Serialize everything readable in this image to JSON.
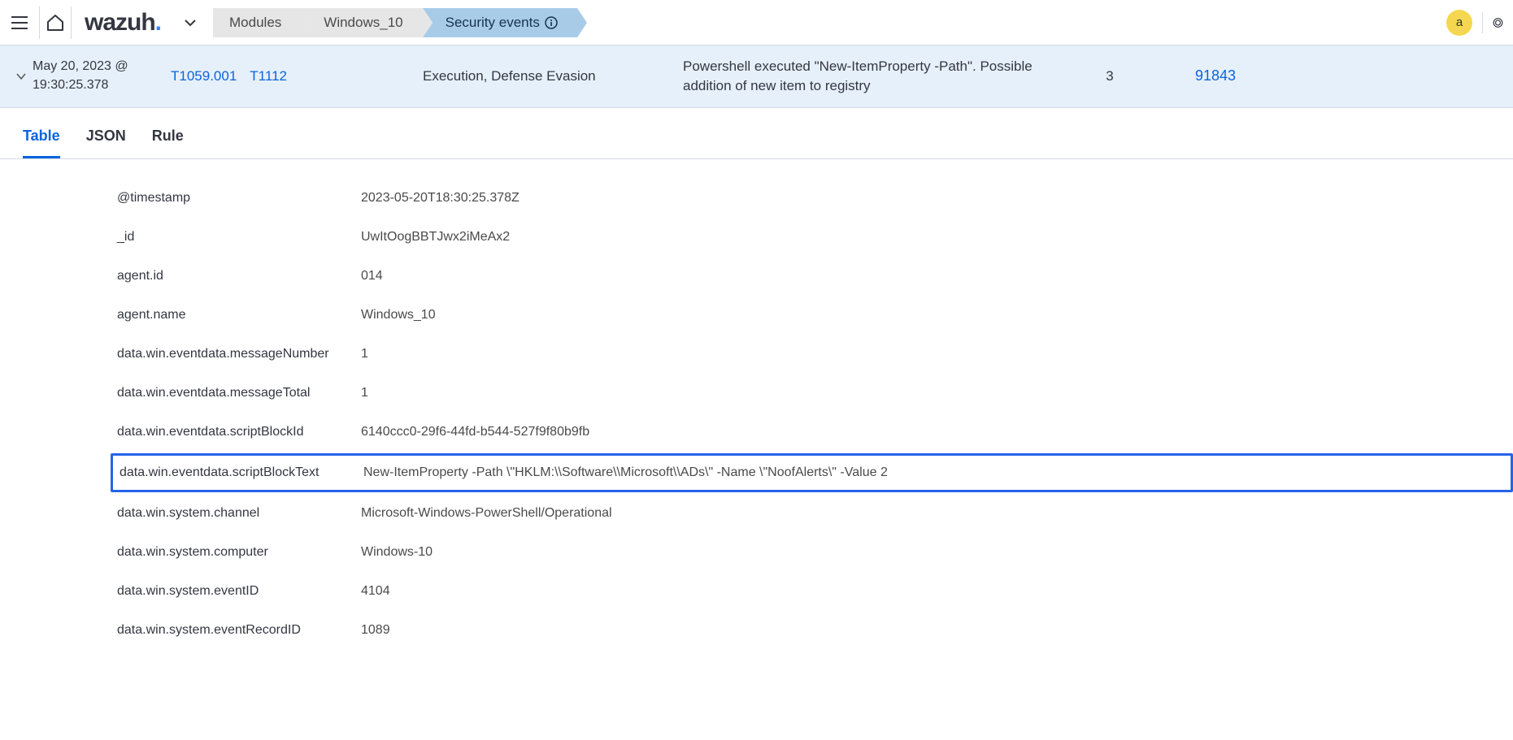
{
  "header": {
    "logo_text": "wazuh",
    "breadcrumbs": [
      {
        "label": "Modules",
        "active": false
      },
      {
        "label": "Windows_10",
        "active": false
      },
      {
        "label": "Security events",
        "active": true,
        "has_info": true
      }
    ],
    "avatar_letter": "a"
  },
  "summary": {
    "timestamp": "May 20, 2023 @ 19:30:25.378",
    "techniques": [
      "T1059.001",
      "T1112"
    ],
    "tactic": "Execution, Defense Evasion",
    "description": "Powershell executed \"New-ItemProperty -Path\". Possible addition of new item to registry",
    "level": "3",
    "rule_id": "91843"
  },
  "tabs": [
    {
      "label": "Table",
      "active": true
    },
    {
      "label": "JSON",
      "active": false
    },
    {
      "label": "Rule",
      "active": false
    }
  ],
  "fields": [
    {
      "key": "@timestamp",
      "value": "2023-05-20T18:30:25.378Z"
    },
    {
      "key": "_id",
      "value": "UwItOogBBTJwx2iMeAx2"
    },
    {
      "key": "agent.id",
      "value": "014"
    },
    {
      "key": "agent.name",
      "value": "Windows_10"
    },
    {
      "key": "data.win.eventdata.messageNumber",
      "value": "1"
    },
    {
      "key": "data.win.eventdata.messageTotal",
      "value": "1"
    },
    {
      "key": "data.win.eventdata.scriptBlockId",
      "value": "6140ccc0-29f6-44fd-b544-527f9f80b9fb"
    },
    {
      "key": "data.win.eventdata.scriptBlockText",
      "value": "New-ItemProperty -Path \\\"HKLM:\\\\Software\\\\Microsoft\\\\ADs\\\" -Name \\\"NoofAlerts\\\" -Value 2",
      "highlighted": true
    },
    {
      "key": "data.win.system.channel",
      "value": "Microsoft-Windows-PowerShell/Operational"
    },
    {
      "key": "data.win.system.computer",
      "value": "Windows-10"
    },
    {
      "key": "data.win.system.eventID",
      "value": "4104"
    },
    {
      "key": "data.win.system.eventRecordID",
      "value": "1089"
    }
  ]
}
